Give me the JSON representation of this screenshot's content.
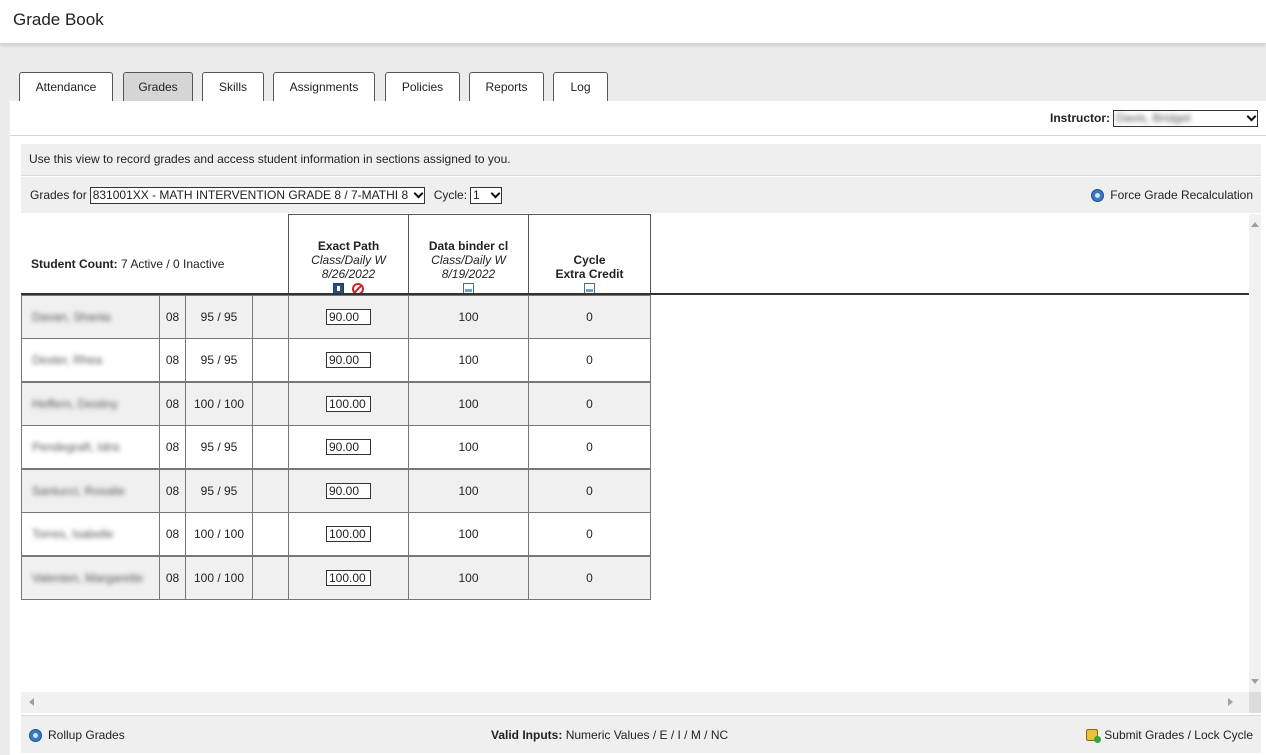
{
  "app": {
    "title": "Grade Book",
    "corner_glyph": "'"
  },
  "tabs": [
    {
      "label": "Attendance",
      "active": false
    },
    {
      "label": "Grades",
      "active": true
    },
    {
      "label": "Skills",
      "active": false
    },
    {
      "label": "Assignments",
      "active": false
    },
    {
      "label": "Policies",
      "active": false
    },
    {
      "label": "Reports",
      "active": false
    },
    {
      "label": "Log",
      "active": false
    }
  ],
  "instructor": {
    "label": "Instructor:",
    "value": "Davis, Bridget"
  },
  "info": {
    "text": "Use this view to record grades and access student information in sections assigned to you."
  },
  "filters": {
    "grades_for_label": "Grades for",
    "section_value": "831001XX - MATH INTERVENTION GRADE 8 / 7-MATHI 8",
    "cycle_label": "Cycle:",
    "cycle_value": "1",
    "force_recalc_label": "Force Grade Recalculation"
  },
  "grid": {
    "student_count_label": "Student Count:",
    "student_count_value": "7 Active / 0 Inactive",
    "columns": [
      {
        "title": "Exact Path",
        "category": "Class/Daily W",
        "date": "8/26/2022",
        "icons": [
          "import-icon",
          "not-allowed-icon"
        ]
      },
      {
        "title": "Data binder cl",
        "category": "Class/Daily W",
        "date": "8/19/2022",
        "icons": [
          "document-icon"
        ]
      },
      {
        "title": "Cycle",
        "category": "Extra Credit",
        "date": "",
        "icons": [
          "document-icon"
        ]
      }
    ],
    "students": [
      {
        "name": "Davan, Shania",
        "grade_level": "08",
        "average": "95 / 95",
        "exact_path": "90.00",
        "data_binder": "100",
        "extra_credit": "0"
      },
      {
        "name": "Dexter, Rhea",
        "grade_level": "08",
        "average": "95 / 95",
        "exact_path": "90.00",
        "data_binder": "100",
        "extra_credit": "0"
      },
      {
        "name": "Heffern, Destiny",
        "grade_level": "08",
        "average": "100 / 100",
        "exact_path": "100.00",
        "data_binder": "100",
        "extra_credit": "0"
      },
      {
        "name": "Pendegraft, Idris",
        "grade_level": "08",
        "average": "95 / 95",
        "exact_path": "90.00",
        "data_binder": "100",
        "extra_credit": "0"
      },
      {
        "name": "Santucci, Rosalie",
        "grade_level": "08",
        "average": "95 / 95",
        "exact_path": "90.00",
        "data_binder": "100",
        "extra_credit": "0"
      },
      {
        "name": "Torres, Isabelle",
        "grade_level": "08",
        "average": "100 / 100",
        "exact_path": "100.00",
        "data_binder": "100",
        "extra_credit": "0"
      },
      {
        "name": "Valenten, Margarette",
        "grade_level": "08",
        "average": "100 / 100",
        "exact_path": "100.00",
        "data_binder": "100",
        "extra_credit": "0"
      }
    ]
  },
  "footer": {
    "rollup_label": "Rollup Grades",
    "valid_inputs_label": "Valid Inputs:",
    "valid_inputs_value": "Numeric Values / E / I / M / NC",
    "submit_label": "Submit Grades / Lock Cycle"
  },
  "colors": {
    "active_tab": "#d5d5d5",
    "row_background": "#f0f0f0",
    "link_icon": "#3a78c3"
  }
}
